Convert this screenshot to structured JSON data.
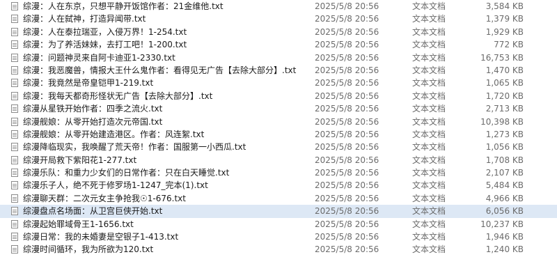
{
  "files": [
    {
      "name": "综漫：人在东京，只想平静开饭馆作者：21金维他.txt",
      "date": "2025/5/8 20:56",
      "type": "文本文档",
      "size": "3,584 KB"
    },
    {
      "name": "综漫：人在弑神，打造异闻带.txt",
      "date": "2025/5/8 20:56",
      "type": "文本文档",
      "size": "1,379 KB"
    },
    {
      "name": "综漫：人在泰拉瑞亚，入侵万界！1-254.txt",
      "date": "2025/5/8 20:56",
      "type": "文本文档",
      "size": "1,929 KB"
    },
    {
      "name": "综漫：为了养活妹妹，去打工吧！1-200.txt",
      "date": "2025/5/8 20:56",
      "type": "文本文档",
      "size": "772 KB"
    },
    {
      "name": "综漫：问题神灵来自阿卡迪亚1-2330.txt",
      "date": "2025/5/8 20:56",
      "type": "文本文档",
      "size": "16,753 KB"
    },
    {
      "name": "综漫：我恶魔兽，情报大王什么鬼作者：看得见无广告【去除大部分】.txt",
      "date": "2025/5/8 20:56",
      "type": "文本文档",
      "size": "1,470 KB"
    },
    {
      "name": "综漫：我竟然是帝皇铠甲1-219.txt",
      "date": "2025/5/8 20:56",
      "type": "文本文档",
      "size": "1,065 KB"
    },
    {
      "name": "综漫：我每天都奇形怪状无广告【去除大部分】.txt",
      "date": "2025/5/8 20:56",
      "type": "文本文档",
      "size": "1,720 KB"
    },
    {
      "name": "综漫从星铁开始作者：四季之流火.txt",
      "date": "2025/5/8 20:56",
      "type": "文本文档",
      "size": "2,713 KB"
    },
    {
      "name": "综漫舰娘：从零开始打造次元帝国.txt",
      "date": "2025/5/8 20:56",
      "type": "文本文档",
      "size": "10,398 KB"
    },
    {
      "name": "综漫舰娘：从零开始建造港区。作者：风连絮.txt",
      "date": "2025/5/8 20:56",
      "type": "文本文档",
      "size": "1,273 KB"
    },
    {
      "name": "综漫降临现实，我唤醒了荒天帝！作者：国服第一小西瓜.txt",
      "date": "2025/5/8 20:56",
      "type": "文本文档",
      "size": "1,056 KB"
    },
    {
      "name": "综漫开局救下紫阳花1-277.txt",
      "date": "2025/5/8 20:56",
      "type": "文本文档",
      "size": "1,708 KB"
    },
    {
      "name": "综漫乐队：和重力少女们的日常作者：只在白天睡觉.txt",
      "date": "2025/5/8 20:56",
      "type": "文本文档",
      "size": "2,107 KB"
    },
    {
      "name": "综漫乐子人，绝不死于修罗场1-1247_完本(1).txt",
      "date": "2025/5/8 20:56",
      "type": "文本文档",
      "size": "5,484 KB"
    },
    {
      "name": "综漫聊天群：二次元女主争抢我☉1-676.txt",
      "date": "2025/5/8 20:56",
      "type": "文本文档",
      "size": "4,966 KB"
    },
    {
      "name": "综漫盘点名场面：从卫宫巨侠开始.txt",
      "date": "2025/5/8 20:56",
      "type": "文本文档",
      "size": "6,056 KB",
      "selected": true
    },
    {
      "name": "综漫起始罪域骨王1-1656.txt",
      "date": "2025/5/8 20:56",
      "type": "文本文档",
      "size": "10,237 KB"
    },
    {
      "name": "综漫日常：我的未婚妻是空银子1-413.txt",
      "date": "2025/5/8 20:56",
      "type": "文本文档",
      "size": "1,946 KB"
    },
    {
      "name": "综漫时间循环，我为所欲为120.txt",
      "date": "2025/5/8 20:56",
      "type": "文本文档",
      "size": "1,240 KB"
    }
  ]
}
